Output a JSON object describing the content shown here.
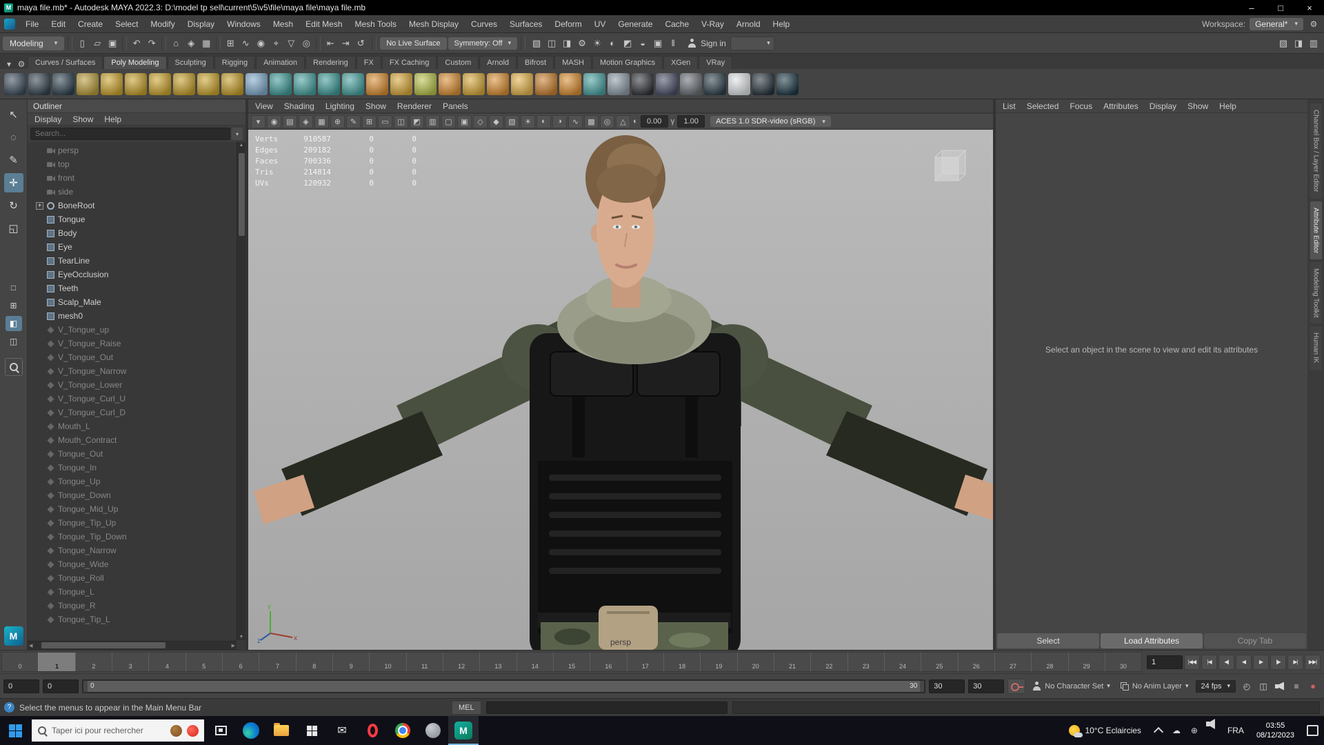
{
  "title_bar": {
    "title": "maya file.mb* - Autodesk MAYA 2022.3: D:\\model tp sell\\current\\5\\v5\\file\\maya file\\maya file.mb"
  },
  "window_controls": {
    "minimize": "–",
    "maximize": "□",
    "close": "×"
  },
  "menu_bar": {
    "items": [
      "File",
      "Edit",
      "Create",
      "Select",
      "Modify",
      "Display",
      "Windows",
      "Mesh",
      "Edit Mesh",
      "Mesh Tools",
      "Mesh Display",
      "Curves",
      "Surfaces",
      "Deform",
      "UV",
      "Generate",
      "Cache",
      "V-Ray",
      "Arnold",
      "Help"
    ],
    "workspace_label": "Workspace:",
    "workspace_value": "General*"
  },
  "status_line": {
    "mode": "Modeling",
    "groups": [
      {
        "icons": [
          {
            "name": "new-scene-icon",
            "glyph": "▯"
          },
          {
            "name": "open-scene-icon",
            "glyph": "▱"
          },
          {
            "name": "save-scene-icon",
            "glyph": "▣"
          }
        ]
      },
      {
        "icons": [
          {
            "name": "undo-icon",
            "glyph": "↶"
          },
          {
            "name": "redo-icon",
            "glyph": "↷"
          }
        ]
      },
      {
        "icons": [
          {
            "name": "select-by-hierarchy-icon",
            "glyph": "⌂"
          },
          {
            "name": "select-by-object-icon",
            "glyph": "◈"
          },
          {
            "name": "select-by-component-icon",
            "glyph": "▦"
          }
        ]
      },
      {
        "icons": [
          {
            "name": "snap-to-grid-icon",
            "glyph": "⊞"
          },
          {
            "name": "snap-to-curve-icon",
            "glyph": "∿"
          },
          {
            "name": "snap-to-point-icon",
            "glyph": "◉"
          },
          {
            "name": "snap-to-projected-center-icon",
            "glyph": "⌖"
          },
          {
            "name": "snap-to-view-plane-icon",
            "glyph": "▽"
          },
          {
            "name": "make-live-icon",
            "glyph": "◎"
          }
        ]
      },
      {
        "icons": [
          {
            "name": "input-connections-icon",
            "glyph": "⇤"
          },
          {
            "name": "output-connections-icon",
            "glyph": "⇥"
          },
          {
            "name": "construction-history-icon",
            "glyph": "↺"
          }
        ]
      }
    ],
    "live_surface": "No Live Surface",
    "symmetry": "Symmetry: Off",
    "render_icons": [
      {
        "name": "render-view-icon",
        "glyph": "▧"
      },
      {
        "name": "render-current-frame-icon",
        "glyph": "◫"
      },
      {
        "name": "ipr-render-icon",
        "glyph": "◨"
      },
      {
        "name": "render-settings-icon",
        "glyph": "⚙"
      },
      {
        "name": "light-editor-icon",
        "glyph": "☀"
      },
      {
        "name": "toon-outline-icon",
        "glyph": "◐"
      },
      {
        "name": "hypershade-icon",
        "glyph": "◩"
      },
      {
        "name": "look-dev-icon",
        "glyph": "◒"
      },
      {
        "name": "vray-framebuffer-icon",
        "glyph": "▣"
      },
      {
        "name": "pause-viewport-icon",
        "glyph": "‖"
      }
    ],
    "sign_in": "Sign in",
    "sidebar_toggles": [
      {
        "name": "toggle-modeling-toolkit-icon",
        "glyph": "▨"
      },
      {
        "name": "toggle-attribute-editor-icon",
        "glyph": "◨"
      },
      {
        "name": "toggle-channel-box-icon",
        "glyph": "▥"
      }
    ]
  },
  "shelf": {
    "tabs": [
      "Curves / Surfaces",
      "Poly Modeling",
      "Sculpting",
      "Rigging",
      "Animation",
      "Rendering",
      "FX",
      "FX Caching",
      "Custom",
      "Arnold",
      "Bifrost",
      "MASH",
      "Motion Graphics",
      "XGen",
      "VRay"
    ],
    "active_tab": "Poly Modeling",
    "icons": [
      {
        "name": "shelf-wire-sphere-icon",
        "color": "#3c4c5c"
      },
      {
        "name": "shelf-wire-cube-icon",
        "color": "#35434f"
      },
      {
        "name": "shelf-node-graph-icon",
        "color": "#2f4250"
      },
      {
        "name": "shelf-ep-curve-icon",
        "color": "#b79b3a"
      },
      {
        "name": "shelf-poly-sphere-icon",
        "color": "#caa32c"
      },
      {
        "name": "shelf-poly-cube-icon",
        "color": "#c59e2a"
      },
      {
        "name": "shelf-poly-cylinder-icon",
        "color": "#caa32c"
      },
      {
        "name": "shelf-poly-cone-icon",
        "color": "#c59e2a"
      },
      {
        "name": "shelf-poly-torus-icon",
        "color": "#caa32c"
      },
      {
        "name": "shelf-poly-disc-icon",
        "color": "#c59e2a"
      },
      {
        "name": "shelf-poly-plane-icon",
        "color": "#7fa9c9"
      },
      {
        "name": "shelf-extrude-icon",
        "color": "#3f9b98"
      },
      {
        "name": "shelf-bevel-icon",
        "color": "#46a19e"
      },
      {
        "name": "shelf-bridge-icon",
        "color": "#3f9b98"
      },
      {
        "name": "shelf-boolean-icon",
        "color": "#46a19e"
      },
      {
        "name": "shelf-smooth-icon",
        "color": "#d98e32"
      },
      {
        "name": "shelf-mirror-icon",
        "color": "#d7a73a"
      },
      {
        "name": "shelf-quad-draw-icon",
        "color": "#b8c24a"
      },
      {
        "name": "shelf-multi-cut-icon",
        "color": "#d98e32"
      },
      {
        "name": "shelf-target-weld-icon",
        "color": "#d7a73a"
      },
      {
        "name": "shelf-sculpt-icon",
        "color": "#d98e32"
      },
      {
        "name": "shelf-sculpt-smooth-icon",
        "color": "#e3b34a"
      },
      {
        "name": "shelf-sculpt-grab-icon",
        "color": "#c87f2e"
      },
      {
        "name": "shelf-sculpt-pinch-icon",
        "color": "#d98e32"
      },
      {
        "name": "shelf-platonic-icon",
        "color": "#49a0a0"
      },
      {
        "name": "shelf-sweep-mesh-icon",
        "color": "#8d9aa5"
      },
      {
        "name": "shelf-render-sphere-icon",
        "color": "#32343a"
      },
      {
        "name": "shelf-material-sphere-icon",
        "color": "#4a4f66"
      },
      {
        "name": "shelf-texture-sphere-icon",
        "color": "#6a6f76"
      },
      {
        "name": "shelf-light-sphere-icon",
        "color": "#2f3f4a"
      },
      {
        "name": "shelf-frame-icon",
        "color": "#dfe3e6"
      },
      {
        "name": "shelf-arnold-icon",
        "color": "#27343c"
      },
      {
        "name": "shelf-vray-icon",
        "color": "#1e3a45"
      }
    ]
  },
  "toolbox": {
    "tools": [
      {
        "name": "select-tool",
        "glyph": "↖"
      },
      {
        "name": "lasso-tool",
        "glyph": "◌"
      },
      {
        "name": "paint-select-tool",
        "glyph": "✎"
      },
      {
        "name": "move-tool",
        "glyph": "✛",
        "active": true
      },
      {
        "name": "rotate-tool",
        "glyph": "↻"
      },
      {
        "name": "scale-tool",
        "glyph": "◱"
      }
    ],
    "layouts": [
      {
        "name": "single-pane-layout-button",
        "glyph": "□"
      },
      {
        "name": "four-pane-layout-button",
        "glyph": "⊞"
      },
      {
        "name": "persp-outliner-layout-button",
        "glyph": "◧",
        "active": true
      },
      {
        "name": "two-pane-layout-button",
        "glyph": "◫"
      }
    ]
  },
  "outliner": {
    "title": "Outliner",
    "menus": [
      "Display",
      "Show",
      "Help"
    ],
    "search_placeholder": "Search...",
    "items": [
      {
        "label": "persp",
        "type": "camera",
        "dim": true
      },
      {
        "label": "top",
        "type": "camera",
        "dim": true
      },
      {
        "label": "front",
        "type": "camera",
        "dim": true
      },
      {
        "label": "side",
        "type": "camera",
        "dim": true
      },
      {
        "label": "BoneRoot",
        "type": "joint",
        "expandable": true
      },
      {
        "label": "Tongue",
        "type": "mesh"
      },
      {
        "label": "Body",
        "type": "mesh"
      },
      {
        "label": "Eye",
        "type": "mesh"
      },
      {
        "label": "TearLine",
        "type": "mesh"
      },
      {
        "label": "EyeOcclusion",
        "type": "mesh"
      },
      {
        "label": "Teeth",
        "type": "mesh"
      },
      {
        "label": "Scalp_Male",
        "type": "mesh"
      },
      {
        "label": "mesh0",
        "type": "mesh"
      },
      {
        "label": "V_Tongue_up",
        "type": "blend",
        "dim": true
      },
      {
        "label": "V_Tongue_Raise",
        "type": "blend",
        "dim": true
      },
      {
        "label": "V_Tongue_Out",
        "type": "blend",
        "dim": true
      },
      {
        "label": "V_Tongue_Narrow",
        "type": "blend",
        "dim": true
      },
      {
        "label": "V_Tongue_Lower",
        "type": "blend",
        "dim": true
      },
      {
        "label": "V_Tongue_Curl_U",
        "type": "blend",
        "dim": true
      },
      {
        "label": "V_Tongue_Curl_D",
        "type": "blend",
        "dim": true
      },
      {
        "label": "Mouth_L",
        "type": "blend",
        "dim": true
      },
      {
        "label": "Mouth_Contract",
        "type": "blend",
        "dim": true
      },
      {
        "label": "Tongue_Out",
        "type": "blend",
        "dim": true
      },
      {
        "label": "Tongue_In",
        "type": "blend",
        "dim": true
      },
      {
        "label": "Tongue_Up",
        "type": "blend",
        "dim": true
      },
      {
        "label": "Tongue_Down",
        "type": "blend",
        "dim": true
      },
      {
        "label": "Tongue_Mid_Up",
        "type": "blend",
        "dim": true
      },
      {
        "label": "Tongue_Tip_Up",
        "type": "blend",
        "dim": true
      },
      {
        "label": "Tongue_Tip_Down",
        "type": "blend",
        "dim": true
      },
      {
        "label": "Tongue_Narrow",
        "type": "blend",
        "dim": true
      },
      {
        "label": "Tongue_Wide",
        "type": "blend",
        "dim": true
      },
      {
        "label": "Tongue_Roll",
        "type": "blend",
        "dim": true
      },
      {
        "label": "Tongue_L",
        "type": "blend",
        "dim": true
      },
      {
        "label": "Tongue_R",
        "type": "blend",
        "dim": true
      },
      {
        "label": "Tongue_Tip_L",
        "type": "blend",
        "dim": true
      }
    ]
  },
  "viewport": {
    "menus": [
      "View",
      "Shading",
      "Lighting",
      "Show",
      "Renderer",
      "Panels"
    ],
    "toolbar_icons": [
      {
        "name": "select-camera-icon",
        "glyph": "▾"
      },
      {
        "name": "lock-camera-icon",
        "glyph": "◉"
      },
      {
        "name": "camera-attributes-icon",
        "glyph": "▤"
      },
      {
        "name": "bookmarks-icon",
        "glyph": "◈"
      },
      {
        "name": "image-plane-icon",
        "glyph": "▦"
      },
      {
        "name": "pan-zoom-icon",
        "glyph": "⊕"
      },
      {
        "name": "grease-pencil-icon",
        "glyph": "✎"
      },
      {
        "name": "grid-icon",
        "glyph": "⊞"
      },
      {
        "name": "film-gate-icon",
        "glyph": "▭"
      },
      {
        "name": "resolution-gate-icon",
        "glyph": "◫"
      },
      {
        "name": "gate-mask-icon",
        "glyph": "◩"
      },
      {
        "name": "field-chart-icon",
        "glyph": "▥"
      },
      {
        "name": "safe-action-icon",
        "glyph": "▢"
      },
      {
        "name": "safe-title-icon",
        "glyph": "▣"
      },
      {
        "name": "wireframe-icon",
        "glyph": "◇"
      },
      {
        "name": "smooth-shade-icon",
        "glyph": "◆"
      },
      {
        "name": "textured-icon",
        "glyph": "▧"
      },
      {
        "name": "use-all-lights-icon",
        "glyph": "☀"
      },
      {
        "name": "shadows-icon",
        "glyph": "◐"
      },
      {
        "name": "ambient-occlusion-icon",
        "glyph": "◑"
      },
      {
        "name": "motion-blur-icon",
        "glyph": "∿"
      },
      {
        "name": "anti-alias-icon",
        "glyph": "▩"
      },
      {
        "name": "depth-of-field-icon",
        "glyph": "◎"
      },
      {
        "name": "isolate-select-icon",
        "glyph": "△"
      }
    ],
    "exposure": "0.00",
    "gamma": "1.00",
    "colorspace": "ACES 1.0 SDR-video (sRGB)",
    "camera_label": "persp",
    "hud_rows": [
      [
        "Verts",
        "910587",
        "0",
        "0"
      ],
      [
        "Edges",
        "209182",
        "0",
        "0"
      ],
      [
        "Faces",
        "700336",
        "0",
        "0"
      ],
      [
        "Tris",
        "214814",
        "0",
        "0"
      ],
      [
        "UVs",
        "120932",
        "0",
        "0"
      ]
    ],
    "axis_labels": {
      "x": "x",
      "y": "y",
      "z": "z"
    }
  },
  "attribute_editor": {
    "menus": [
      "List",
      "Selected",
      "Focus",
      "Attributes",
      "Display",
      "Show",
      "Help"
    ],
    "message": "Select an object in the scene to view and edit its attributes",
    "buttons": [
      {
        "label": "Select",
        "name": "select-button"
      },
      {
        "label": "Load Attributes",
        "name": "load-attributes-button",
        "highlight": true
      },
      {
        "label": "Copy Tab",
        "name": "copy-tab-button",
        "disabled": true
      }
    ]
  },
  "right_sidebar": {
    "tabs": [
      {
        "label": "Channel Box / Layer Editor"
      },
      {
        "label": "Attribute Editor",
        "active": true
      },
      {
        "label": "Modeling Toolkit"
      },
      {
        "label": "Human IK"
      }
    ]
  },
  "timeline": {
    "start": 0,
    "end": 30,
    "current": 1,
    "current_time": "1",
    "playback": [
      {
        "name": "go-to-start-button",
        "glyph": "|◀◀"
      },
      {
        "name": "step-back-frame-button",
        "glyph": "|◀"
      },
      {
        "name": "step-back-key-button",
        "glyph": "◀|"
      },
      {
        "name": "play-backward-button",
        "glyph": "◀"
      },
      {
        "name": "play-forward-button",
        "glyph": "▶"
      },
      {
        "name": "step-forward-key-button",
        "glyph": "|▶"
      },
      {
        "name": "step-forward-frame-button",
        "glyph": "▶|"
      },
      {
        "name": "go-to-end-button",
        "glyph": "▶▶|"
      }
    ]
  },
  "range_slider": {
    "animation_start": "0",
    "playback_start": "0",
    "range_start_label": "0",
    "range_end_label": "30",
    "playback_end": "30",
    "animation_end": "30",
    "character_set": "No Character Set",
    "anim_layer": "No Anim Layer",
    "fps": "24 fps",
    "extra_icons": [
      {
        "name": "time-editor-icon",
        "glyph": "◴"
      },
      {
        "name": "playblast-icon",
        "glyph": "◫"
      },
      {
        "name": "mute-icon",
        "cls": "speaker"
      },
      {
        "name": "controller-icon",
        "glyph": "≡"
      },
      {
        "name": "auto-key-state-icon",
        "glyph": "●",
        "cls": "record"
      }
    ]
  },
  "command_line": {
    "mel_label": "MEL"
  },
  "help_line": {
    "text": "Select the menus to appear in the Main Menu Bar"
  },
  "taskbar": {
    "search_placeholder": "Taper ici pour rechercher",
    "apps": [
      {
        "name": "start-button",
        "type": "start"
      },
      {
        "name": "search-box",
        "type": "search"
      },
      {
        "name": "task-view-button",
        "type": "taskview"
      },
      {
        "name": "edge-app",
        "type": "edge"
      },
      {
        "name": "file-explorer-app",
        "type": "explorer"
      },
      {
        "name": "store-app",
        "type": "store"
      },
      {
        "name": "mail-app",
        "type": "mail"
      },
      {
        "name": "opera-app",
        "type": "opera"
      },
      {
        "name": "chrome-app",
        "type": "chrome"
      },
      {
        "name": "media-app",
        "type": "gray"
      },
      {
        "name": "maya-app",
        "type": "maya",
        "active": true
      }
    ],
    "weather": "10°C  Eclaircies",
    "language": "FRA",
    "time": "03:55",
    "date": "08/12/2023",
    "tray": [
      {
        "name": "hidden-icons-chevron",
        "cls": "chev"
      },
      {
        "name": "cloud-icon",
        "glyph": "☁"
      },
      {
        "name": "network-icon",
        "glyph": "⊕"
      },
      {
        "name": "volume-icon",
        "cls": "speaker"
      }
    ]
  }
}
